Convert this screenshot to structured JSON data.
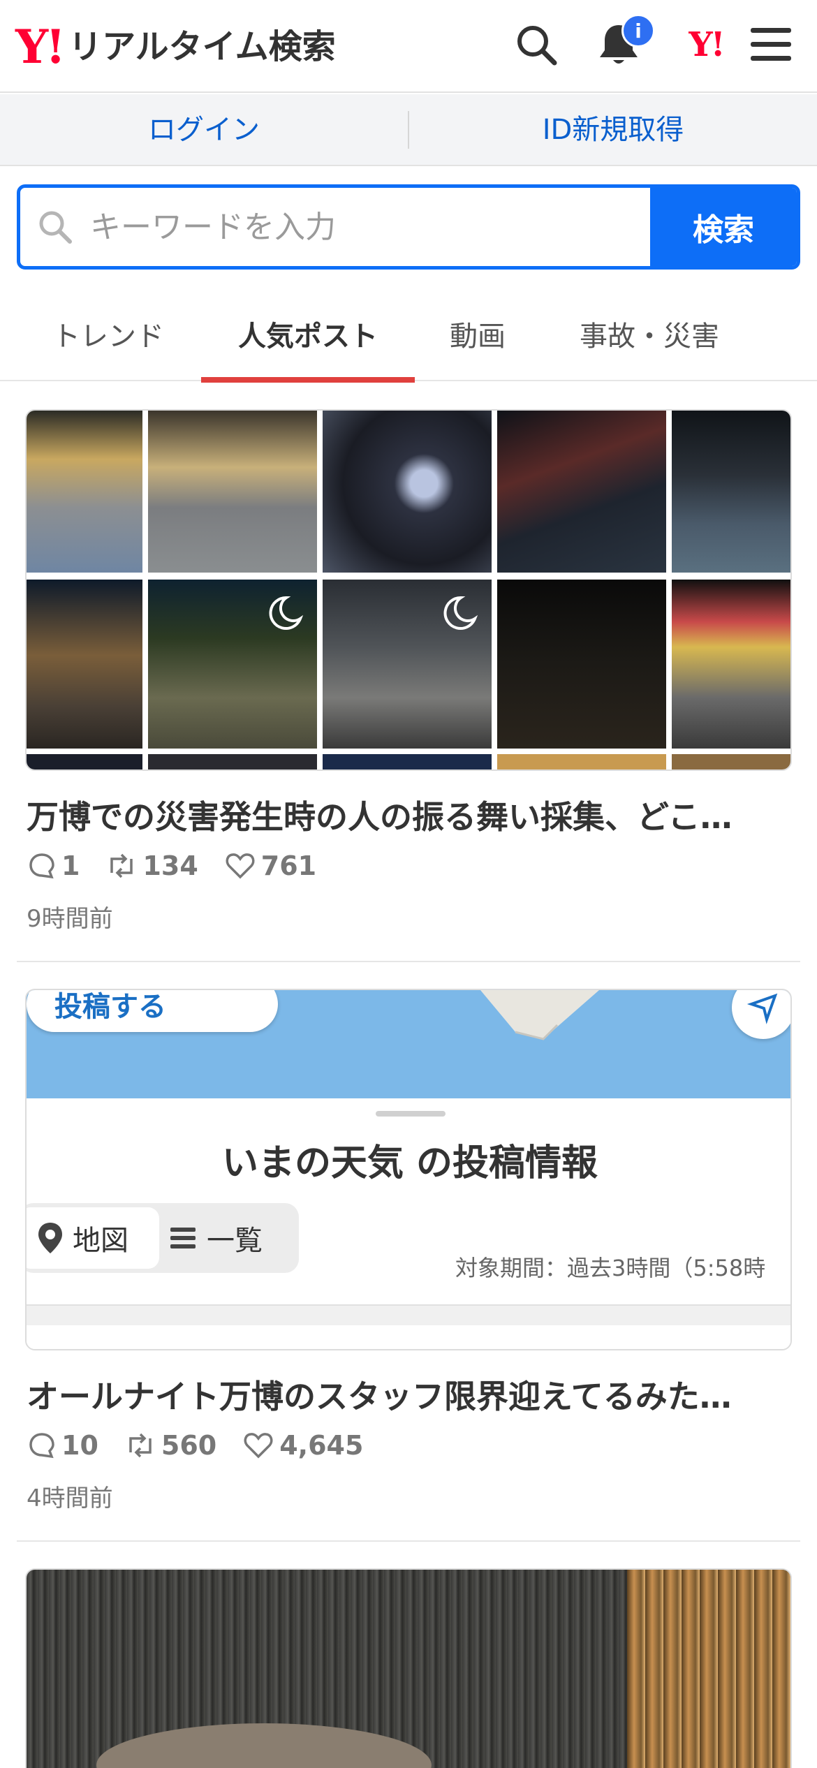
{
  "header": {
    "logo_mark": "Y!",
    "logo_text": "リアルタイム検索",
    "notification_badge": "i",
    "yahoo_icon_text": "Y!"
  },
  "auth": {
    "login": "ログイン",
    "signup": "ID新規取得"
  },
  "search": {
    "placeholder": "キーワードを入力",
    "button": "検索"
  },
  "tabs": [
    {
      "label": "トレンド",
      "active": false
    },
    {
      "label": "人気ポスト",
      "active": true
    },
    {
      "label": "動画",
      "active": false
    },
    {
      "label": "事故・災害",
      "active": false
    }
  ],
  "posts": [
    {
      "title": "万博での災害発生時の人の振る舞い採集、どこ…",
      "replies": "1",
      "reposts": "134",
      "likes": "761",
      "time": "9時間前"
    },
    {
      "title": "オールナイト万博のスタッフ限界迎えてるみた…",
      "replies": "10",
      "reposts": "560",
      "likes": "4,645",
      "time": "4時間前",
      "image_text": {
        "post_button": "投稿する",
        "heading": "いまの天気 の投稿情報",
        "map_tab": "地図",
        "list_tab": "一覧",
        "period": "対象期間：過去3時間（5:58時"
      }
    }
  ],
  "colors": {
    "brand_red": "#ff0033",
    "accent_blue": "#0d6ef7",
    "link_blue": "#0a5fce",
    "tab_underline": "#e0403d"
  }
}
